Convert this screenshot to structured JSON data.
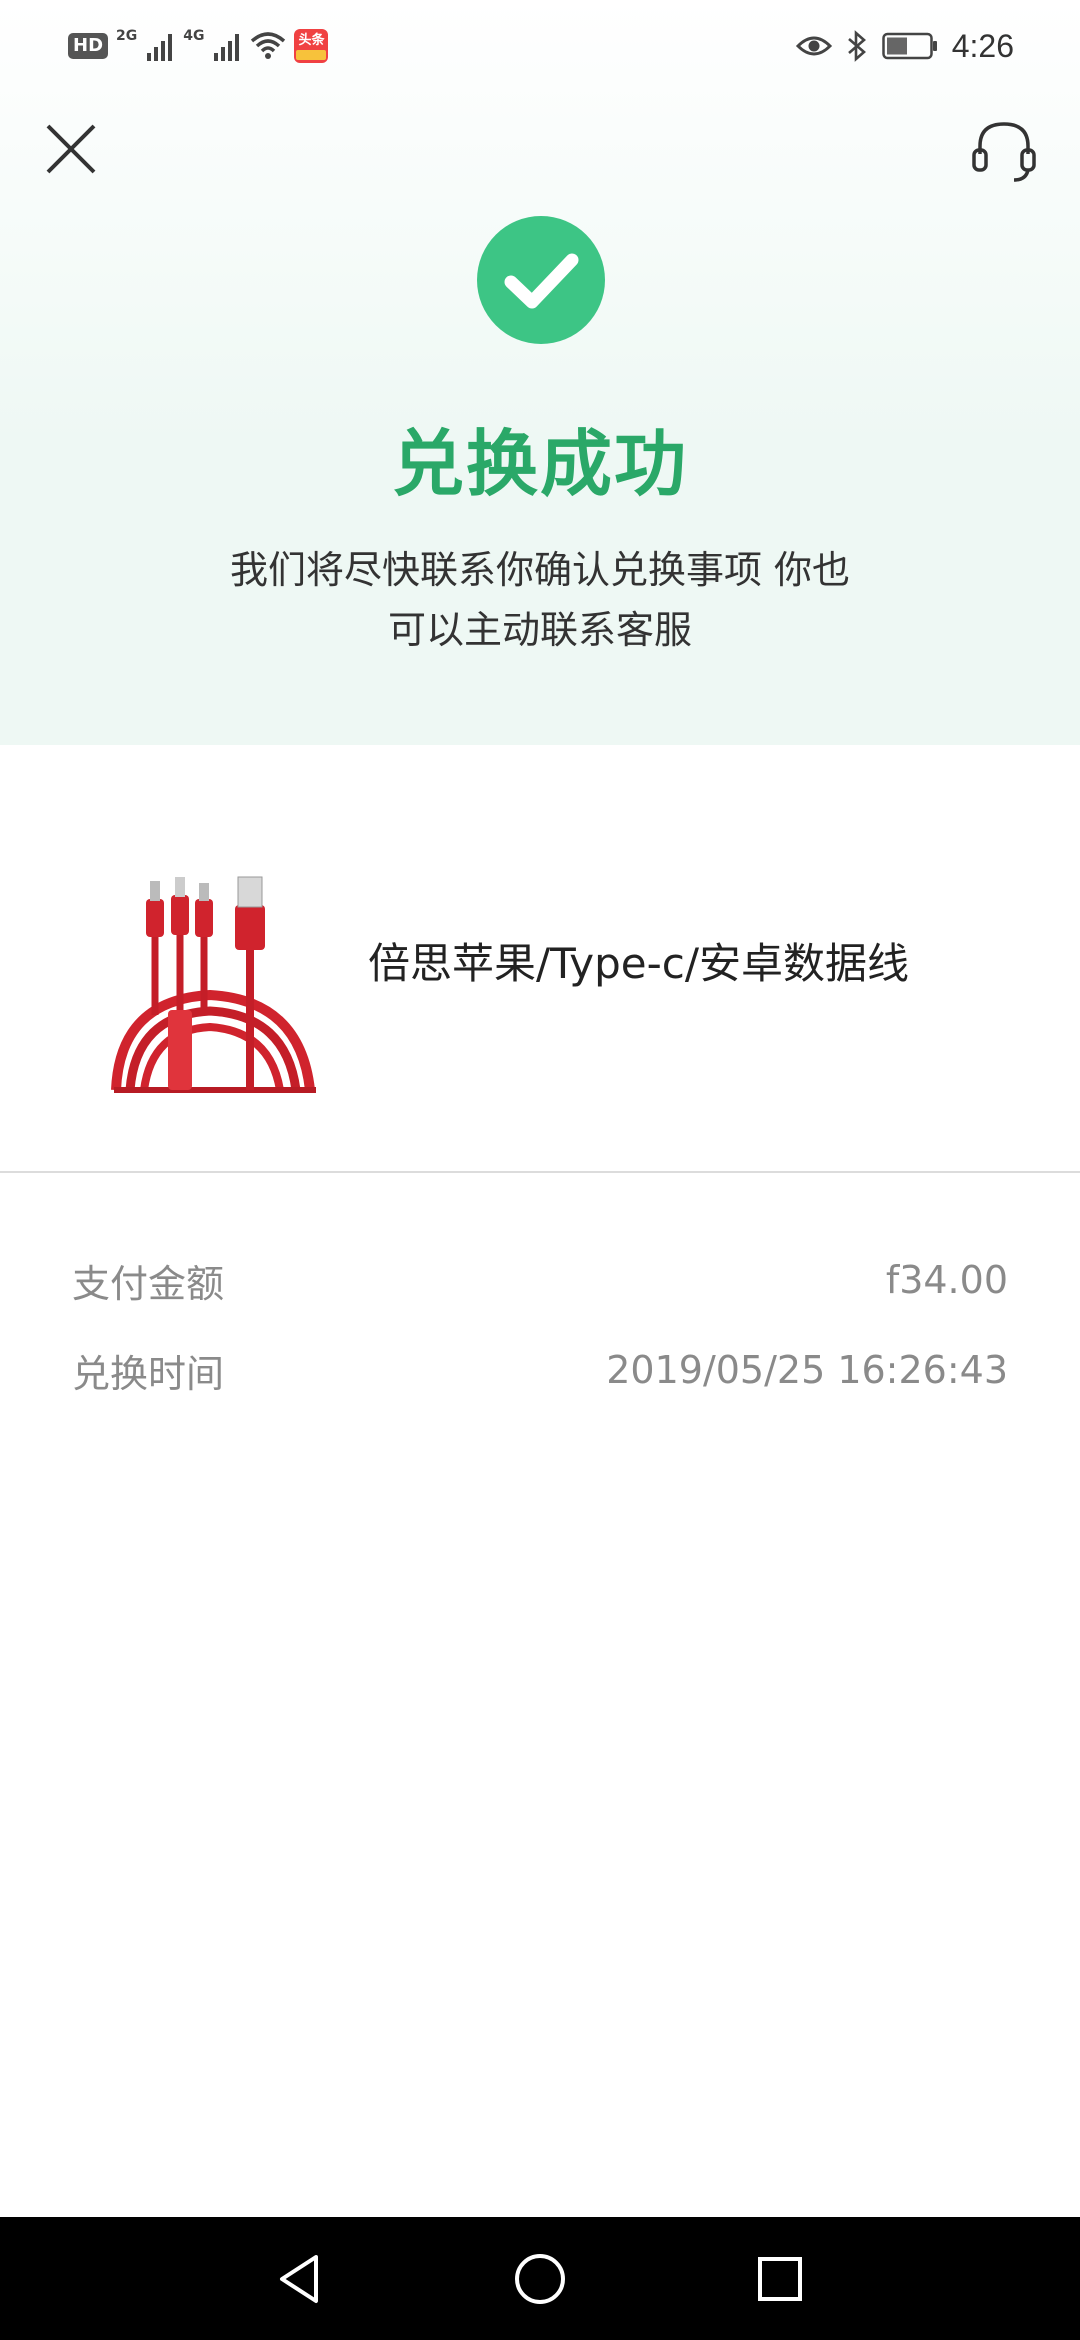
{
  "status_bar": {
    "hd_label": "HD",
    "net_2g": "2G",
    "net_4g": "4G",
    "app_badge_line1": "头条",
    "app_badge_line2": "",
    "time": "4:26"
  },
  "header": {
    "close_icon": "close-icon",
    "support_icon": "headset-icon"
  },
  "result": {
    "title": "兑换成功",
    "description": "我们将尽快联系你确认兑换事项 你也可以主动联系客服"
  },
  "product": {
    "name": "倍思苹果/Type-c/安卓数据线",
    "image_icon": "usb-cable-image",
    "brand_color": "#d0232d"
  },
  "details": [
    {
      "label": "支付金额",
      "value": "f34.00"
    },
    {
      "label": "兑换时间",
      "value": "2019/05/25 16:26:43"
    }
  ],
  "colors": {
    "accent": "#3dc585",
    "title_green": "#2aa868",
    "hero_bg": "#eef8f4"
  },
  "nav": {
    "back_icon": "back-triangle-icon",
    "home_icon": "home-circle-icon",
    "recents_icon": "recents-square-icon"
  }
}
